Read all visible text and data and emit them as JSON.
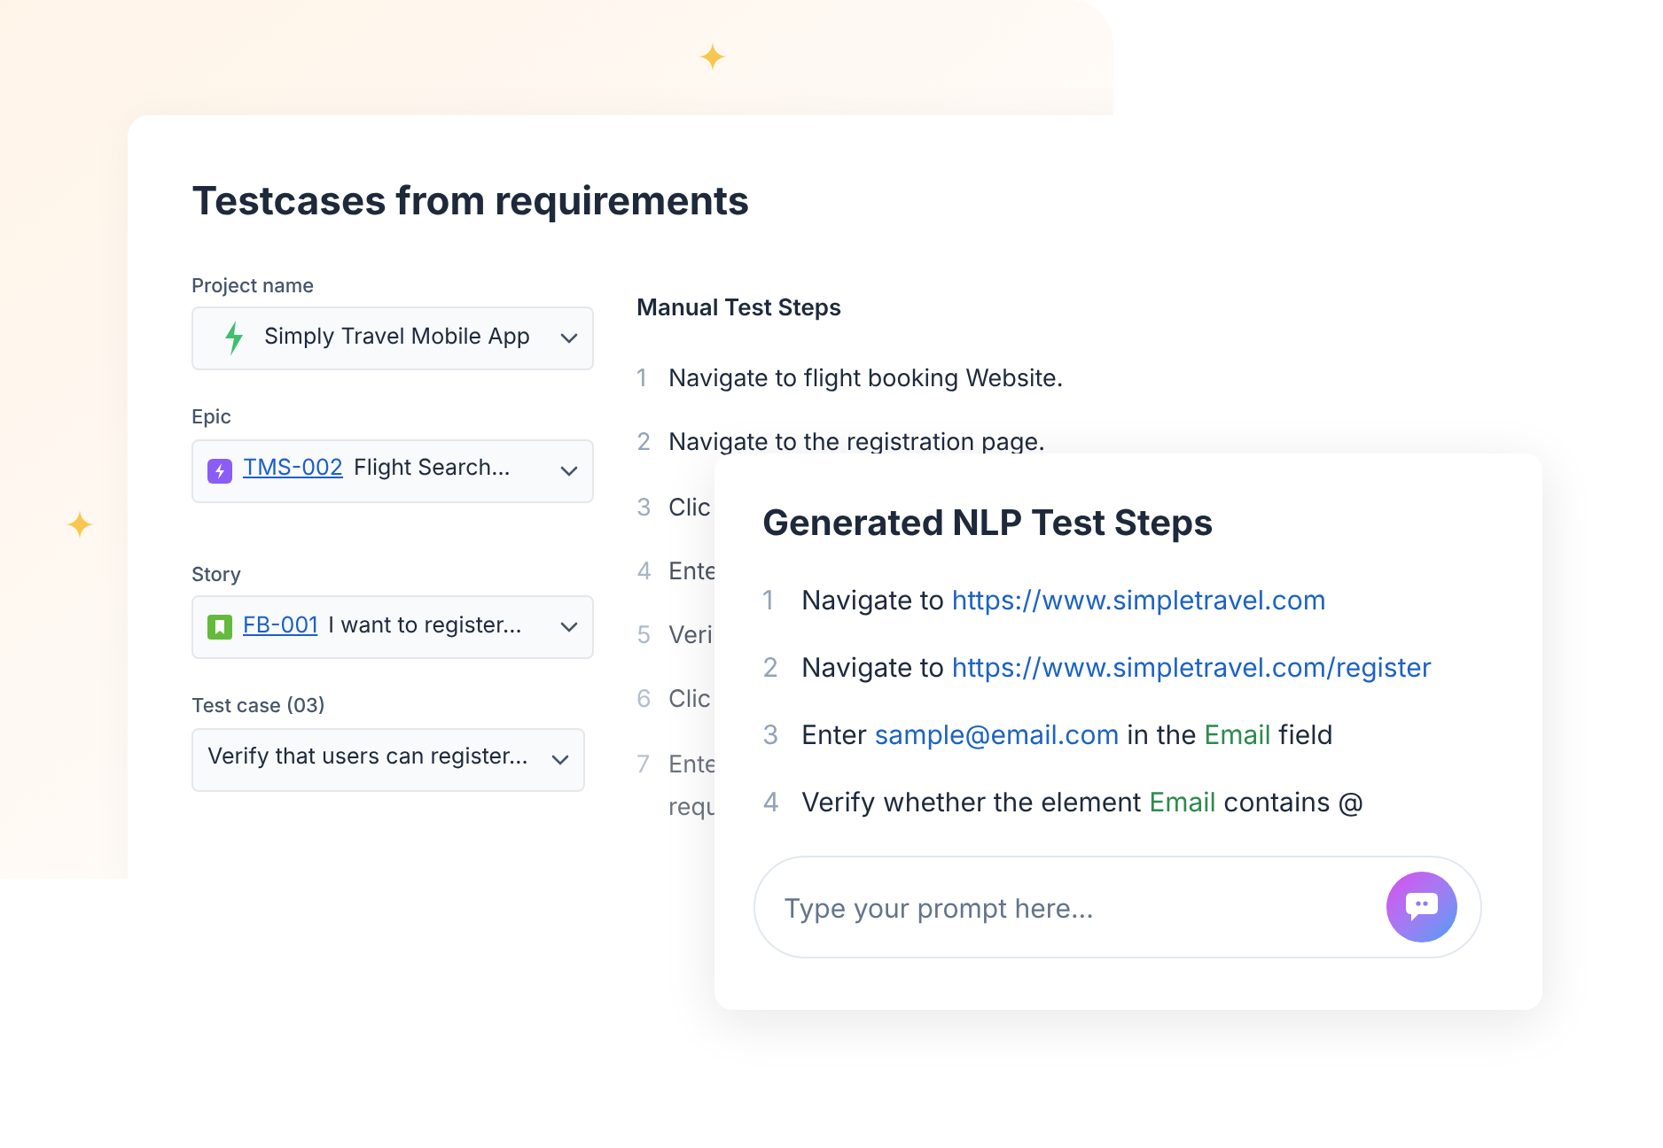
{
  "title": "Testcases from requirements",
  "fields": [
    {
      "label": "Project name",
      "kind": "project",
      "value": "Simply Travel Mobile App"
    },
    {
      "label": "Epic",
      "kind": "epic",
      "key": "TMS-002",
      "value": "Flight Search..."
    },
    {
      "label": "Story",
      "kind": "story",
      "key": "FB-001",
      "value": "I want to register..."
    },
    {
      "label": "Test case (03)",
      "kind": "plain",
      "value": "Verify that users can register..."
    }
  ],
  "manual": {
    "heading": "Manual Test Steps",
    "steps": [
      {
        "num": "1",
        "lines": [
          "Navigate to flight booking Website."
        ]
      },
      {
        "num": "2",
        "lines": [
          "Navigate to the registration page."
        ]
      },
      {
        "num": "3",
        "lines": [
          "Clic"
        ]
      },
      {
        "num": "4",
        "lines": [
          "Ente"
        ]
      },
      {
        "num": "5",
        "lines": [
          "Veri"
        ]
      },
      {
        "num": "6",
        "lines": [
          "Clic"
        ]
      },
      {
        "num": "7",
        "lines": [
          "Ente",
          "requ"
        ]
      }
    ]
  },
  "nlp": {
    "heading": "Generated NLP Test Steps",
    "steps": [
      {
        "num": "1",
        "parts": [
          {
            "kind": "text",
            "text": "Navigate to "
          },
          {
            "kind": "link",
            "text": "https://www.simpletravel.com"
          }
        ]
      },
      {
        "num": "2",
        "parts": [
          {
            "kind": "text",
            "text": "Navigate to "
          },
          {
            "kind": "link",
            "text": "https://www.simpletravel.com/register"
          }
        ]
      },
      {
        "num": "3",
        "parts": [
          {
            "kind": "text",
            "text": "Enter "
          },
          {
            "kind": "link",
            "text": "sample@email.com"
          },
          {
            "kind": "text",
            "text": " in the "
          },
          {
            "kind": "element",
            "text": "Email"
          },
          {
            "kind": "text",
            "text": " field"
          }
        ]
      },
      {
        "num": "4",
        "parts": [
          {
            "kind": "text",
            "text": "Verify whether the element "
          },
          {
            "kind": "element",
            "text": "Email"
          },
          {
            "kind": "text",
            "text": " contains @"
          }
        ]
      }
    ],
    "prompt": {
      "placeholder": "Type your prompt here..."
    }
  }
}
